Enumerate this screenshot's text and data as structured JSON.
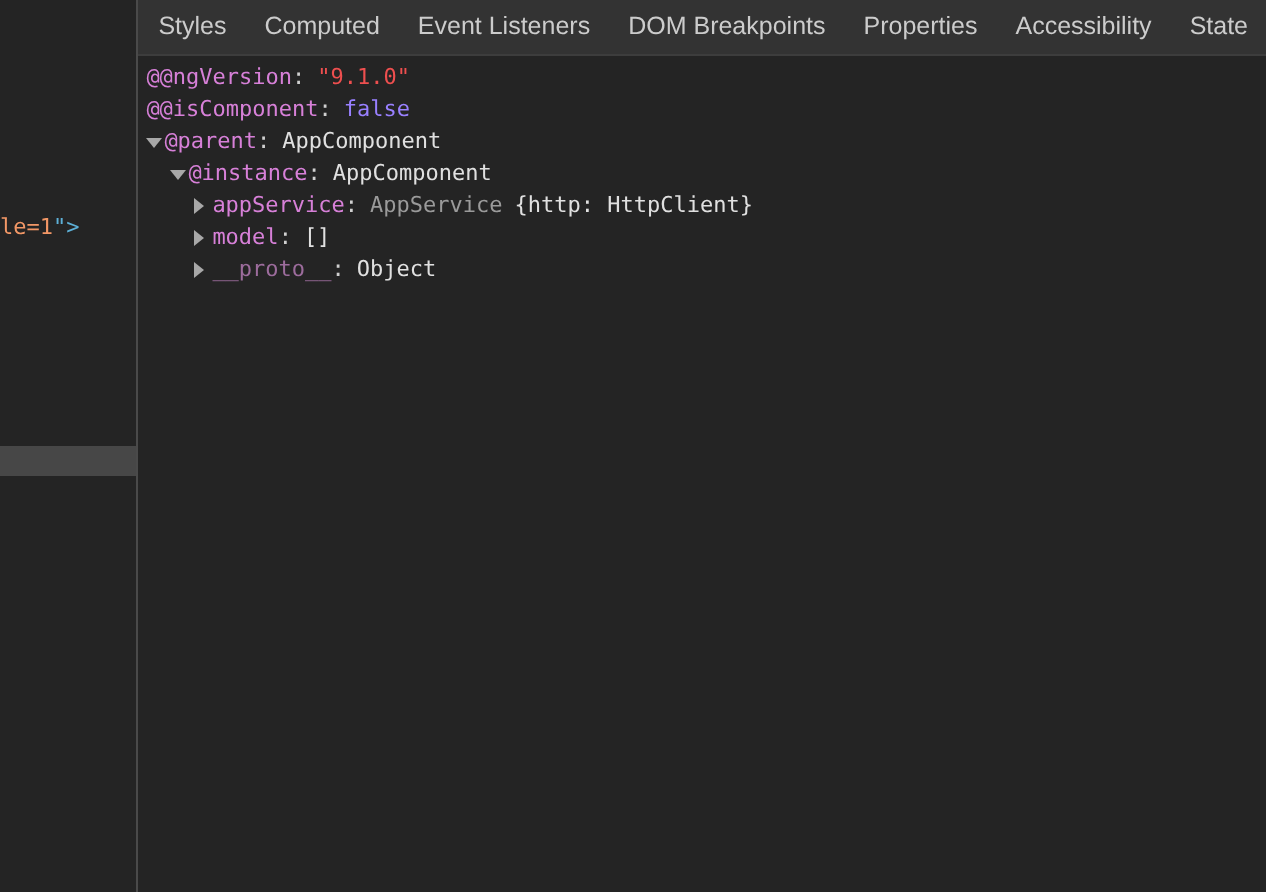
{
  "elements_pane": {
    "lines": [
      {
        "attr_tail": "le=1",
        "punct": "\">",
        "selected": false
      },
      {
        "selected": true
      }
    ]
  },
  "tabs": [
    {
      "label": "Styles",
      "selected": false
    },
    {
      "label": "Computed",
      "selected": false
    },
    {
      "label": "Event Listeners",
      "selected": false
    },
    {
      "label": "DOM Breakpoints",
      "selected": false
    },
    {
      "label": "Properties",
      "selected": false
    },
    {
      "label": "Accessibility",
      "selected": false
    },
    {
      "label": "State",
      "selected": false
    }
  ],
  "properties": [
    {
      "key": "@@ngVersion",
      "sep": ":",
      "value": "\"9.1.0\"",
      "kind": "string"
    },
    {
      "key": "@@isComponent",
      "sep": ":",
      "value": "false",
      "kind": "keyword"
    },
    {
      "key": "@parent",
      "sep": ":",
      "value": "AppComponent",
      "expanded": true,
      "children": [
        {
          "key": "@instance",
          "sep": ":",
          "value": "AppComponent",
          "expanded": true,
          "children": [
            {
              "key": "appService",
              "sep": ":",
              "class_name": "AppService",
              "value": "{http: HttpClient}",
              "expanded": false
            },
            {
              "key": "model",
              "sep": ":",
              "value": "[]",
              "expanded": false
            },
            {
              "key": "__proto__",
              "sep": ":",
              "value": "Object",
              "kind": "internal",
              "expanded": false
            }
          ]
        }
      ]
    }
  ]
}
